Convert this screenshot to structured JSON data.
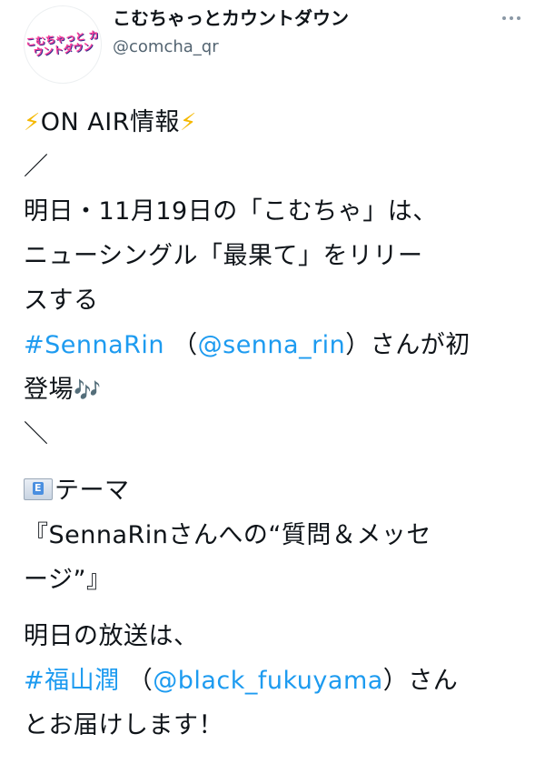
{
  "account": {
    "avatar_text": "こむちゃっと カウントダウン",
    "display_name": "こむちゃっとカウントダウン",
    "handle": "@comcha_qr"
  },
  "tweet": {
    "bolt": "⚡",
    "heading": "ON AIR情報",
    "slash_open": "／",
    "line1": "明日・11月19日の「こむちゃ」は、",
    "line2": "ニューシングル「最果て」をリリー",
    "line3": "スする",
    "hashtag_sennarin": "#SennaRin",
    "paren_open": " （",
    "mention_senna": "@senna_rin",
    "line4_tail": "）さんが初",
    "line5": "登場",
    "notes": "🎶",
    "slash_close": "＼",
    "mail_letter": "E",
    "theme_label": "テーマ",
    "theme_line1": "『SennaRinさんへの“質問＆メッセ",
    "theme_line2": "ージ”』",
    "broadcast_line1": "明日の放送は、",
    "hashtag_fukuyama": "#福山潤",
    "mention_fukuyama": "@black_fukuyama",
    "fukuyama_tail": "）さん",
    "closing": "とお届けします！"
  },
  "icons": {
    "more": "more-icon",
    "bolt": "lightning-icon",
    "notes": "music-notes-icon",
    "mail": "e-mail-icon"
  },
  "colors": {
    "link": "#1d9bf0",
    "handle": "#536471",
    "text": "#0f1419"
  }
}
